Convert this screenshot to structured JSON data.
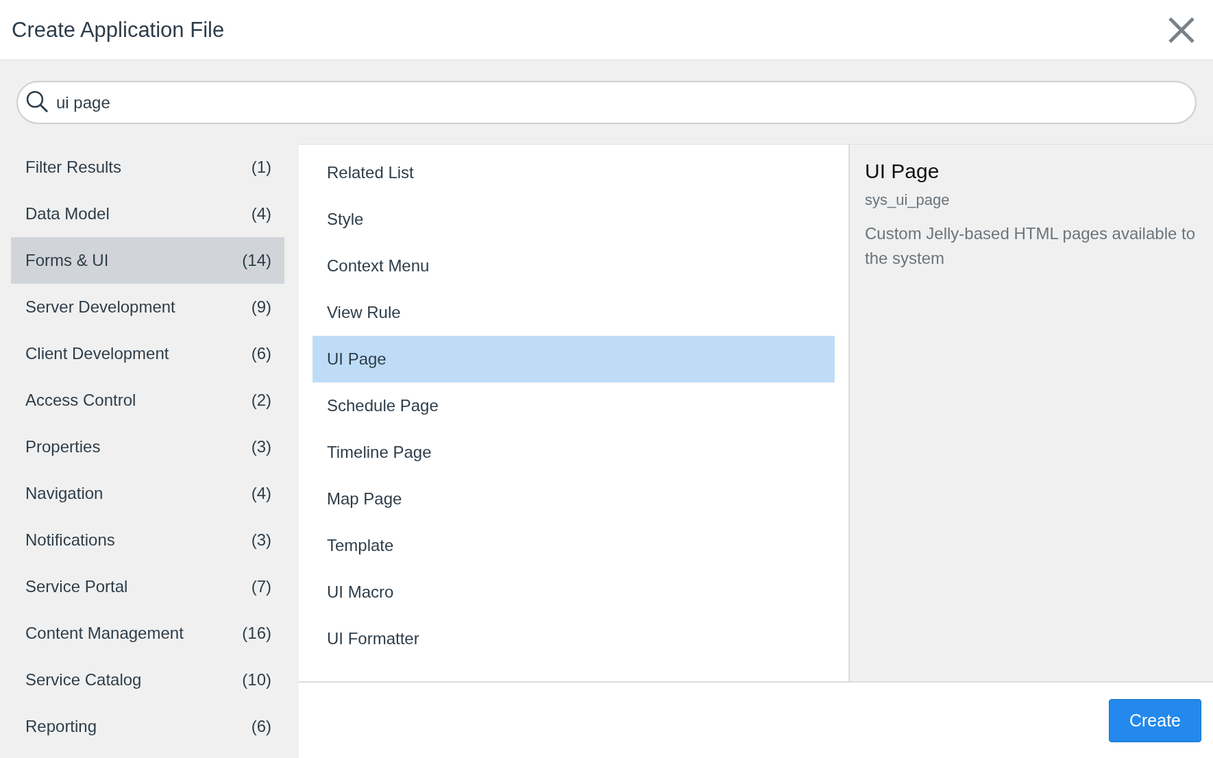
{
  "window": {
    "title": "Create Application File"
  },
  "search": {
    "value": "ui page"
  },
  "categories": [
    {
      "label": "Filter Results",
      "count": "(1)",
      "selected": false
    },
    {
      "label": "Data Model",
      "count": "(4)",
      "selected": false
    },
    {
      "label": "Forms & UI",
      "count": "(14)",
      "selected": true
    },
    {
      "label": "Server Development",
      "count": "(9)",
      "selected": false
    },
    {
      "label": "Client Development",
      "count": "(6)",
      "selected": false
    },
    {
      "label": "Access Control",
      "count": "(2)",
      "selected": false
    },
    {
      "label": "Properties",
      "count": "(3)",
      "selected": false
    },
    {
      "label": "Navigation",
      "count": "(4)",
      "selected": false
    },
    {
      "label": "Notifications",
      "count": "(3)",
      "selected": false
    },
    {
      "label": "Service Portal",
      "count": "(7)",
      "selected": false
    },
    {
      "label": "Content Management",
      "count": "(16)",
      "selected": false
    },
    {
      "label": "Service Catalog",
      "count": "(10)",
      "selected": false
    },
    {
      "label": "Reporting",
      "count": "(6)",
      "selected": false
    }
  ],
  "file_types": [
    {
      "label": "Related List",
      "selected": false
    },
    {
      "label": "Style",
      "selected": false
    },
    {
      "label": "Context Menu",
      "selected": false
    },
    {
      "label": "View Rule",
      "selected": false
    },
    {
      "label": "UI Page",
      "selected": true
    },
    {
      "label": "Schedule Page",
      "selected": false
    },
    {
      "label": "Timeline Page",
      "selected": false
    },
    {
      "label": "Map Page",
      "selected": false
    },
    {
      "label": "Template",
      "selected": false
    },
    {
      "label": "UI Macro",
      "selected": false
    },
    {
      "label": "UI Formatter",
      "selected": false
    }
  ],
  "details": {
    "title": "UI Page",
    "table": "sys_ui_page",
    "description": "Custom Jelly-based HTML pages available to the system"
  },
  "buttons": {
    "create": "Create"
  }
}
